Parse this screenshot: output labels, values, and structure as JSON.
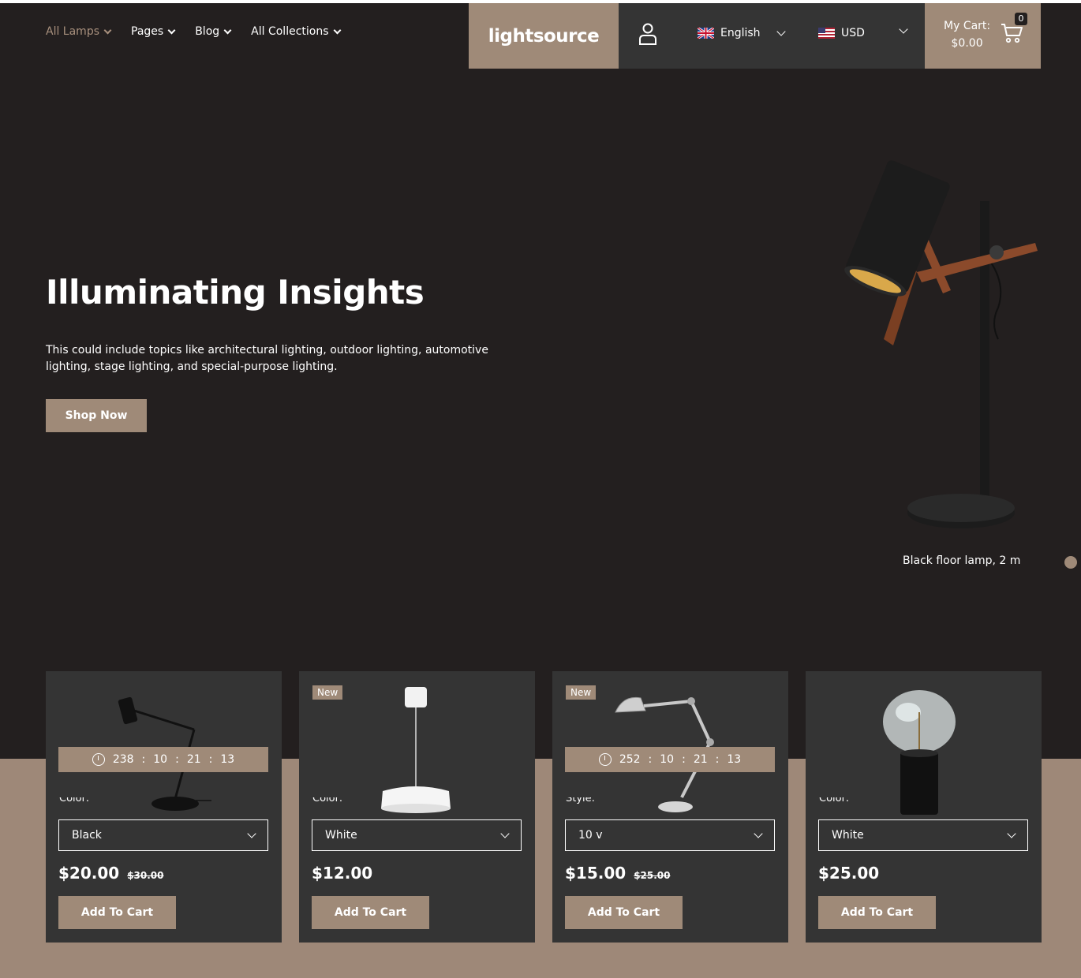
{
  "nav": [
    {
      "label": "All Lamps",
      "active": true
    },
    {
      "label": "Pages"
    },
    {
      "label": "Blog"
    },
    {
      "label": "All Collections"
    }
  ],
  "logo": "lightsource",
  "language": "English",
  "currency": "USD",
  "cart": {
    "label": "My Cart:",
    "total": "$0.00",
    "count": "0"
  },
  "hero": {
    "title": "Illuminating Insights",
    "text": "This could include topics like architectural lighting, outdoor lighting, automotive lighting, stage lighting, and special-purpose lighting.",
    "button": "Shop Now",
    "caption": "Black floor lamp, 2 m"
  },
  "products": [
    {
      "badge": "",
      "timer": [
        "238",
        "10",
        "21",
        "13"
      ],
      "option_label": "Color:",
      "option_value": "Black",
      "price": "$20.00",
      "old_price": "$30.00",
      "button": "Add To Cart"
    },
    {
      "badge": "New",
      "timer": null,
      "option_label": "Color:",
      "option_value": "White",
      "price": "$12.00",
      "old_price": "",
      "button": "Add To Cart"
    },
    {
      "badge": "New",
      "timer": [
        "252",
        "10",
        "21",
        "13"
      ],
      "option_label": "Style:",
      "option_value": "10 v",
      "price": "$15.00",
      "old_price": "$25.00",
      "button": "Add To Cart"
    },
    {
      "badge": "",
      "timer": null,
      "option_label": "Color:",
      "option_value": "White",
      "price": "$25.00",
      "old_price": "",
      "button": "Add To Cart"
    }
  ],
  "colors": {
    "accent": "#9f8a78",
    "background": "#231f1f",
    "card": "#343434"
  }
}
